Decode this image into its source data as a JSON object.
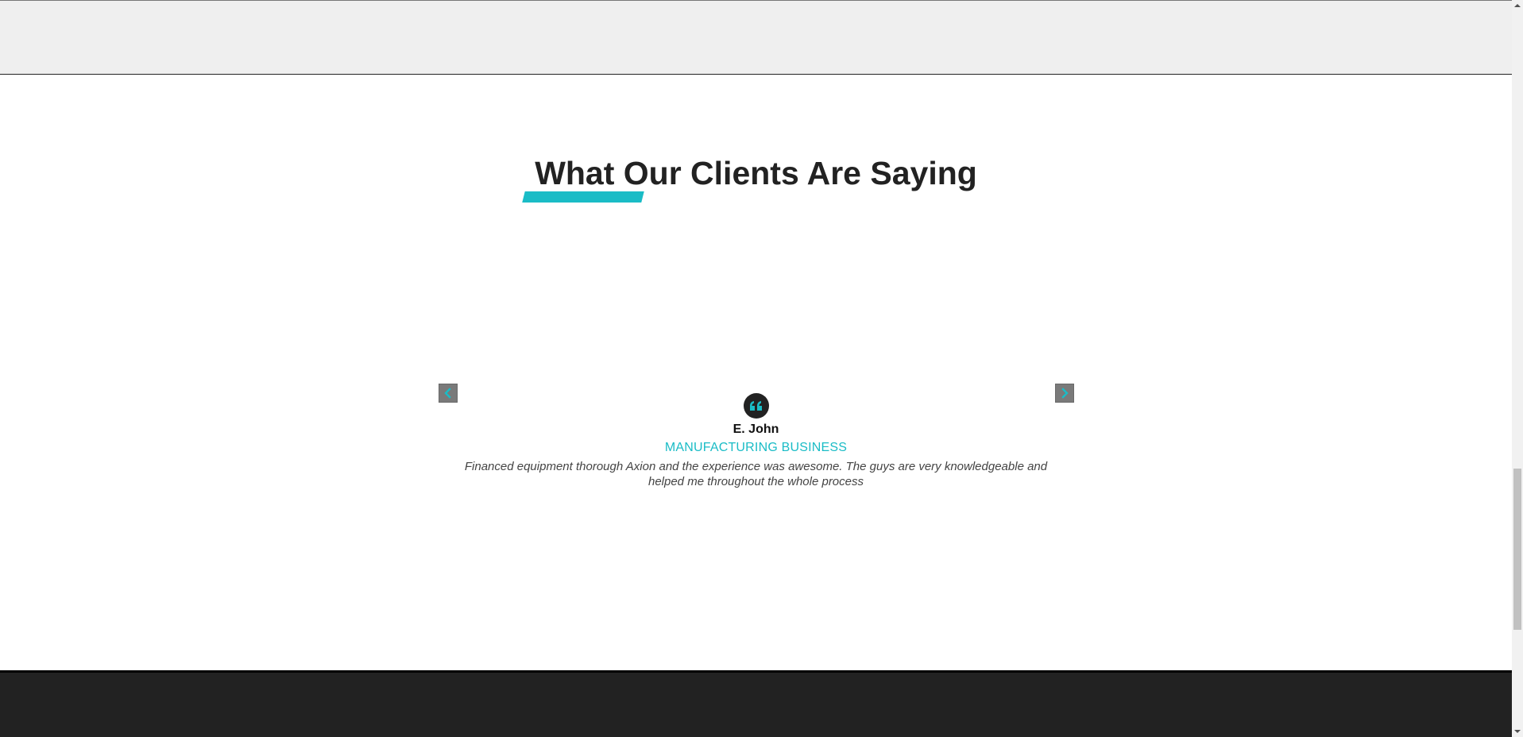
{
  "testimonials": {
    "title": "What Our Clients Are Saying",
    "accent_color": "#1abcc6",
    "prev_icon": "chevron-left-icon",
    "next_icon": "chevron-right-icon",
    "quote_icon": "quote-icon",
    "active_slide": {
      "name": "E. John",
      "role": "MANUFACTURING BUSINESS",
      "quote": "Financed equipment thorough Axion and the experience was awesome. The guys are very knowledgeable and helped me throughout the whole process"
    }
  },
  "colors": {
    "top_band": "#efefef",
    "footer": "#222222",
    "heading": "#222222"
  }
}
